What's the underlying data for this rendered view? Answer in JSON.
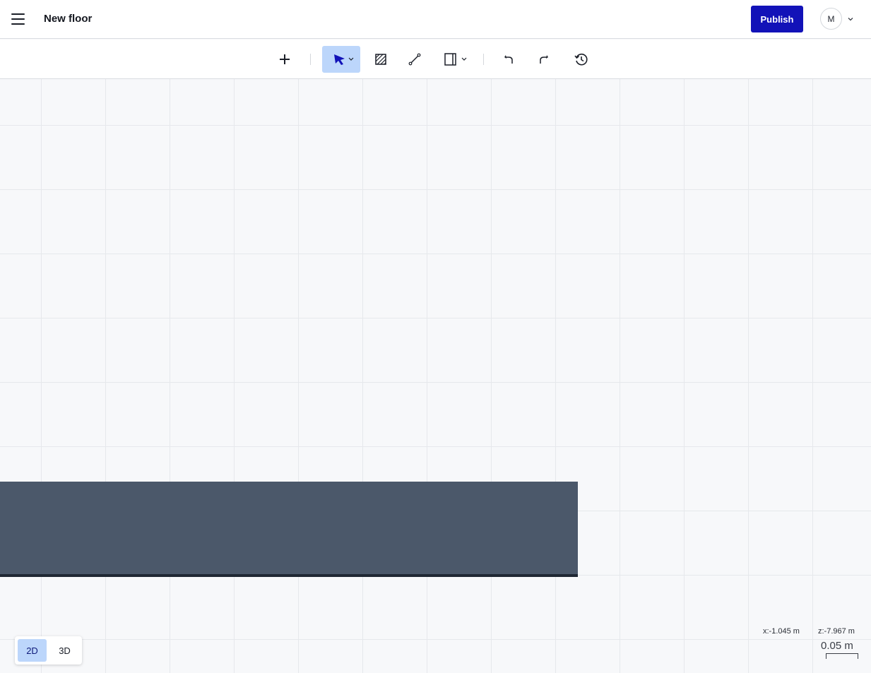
{
  "header": {
    "title": "New floor",
    "publish_label": "Publish",
    "avatar_initial": "M",
    "accent_color": "#1212b8"
  },
  "toolbar": {
    "tools": [
      {
        "icon": "plus-icon",
        "label": "Add"
      },
      {
        "icon": "cursor-arrow-icon",
        "label": "Select",
        "active": true,
        "has_dropdown": true
      },
      {
        "icon": "hatched-area-icon",
        "label": "Area"
      },
      {
        "icon": "line-icon",
        "label": "Line"
      },
      {
        "icon": "door-panel-icon",
        "label": "Door/Window",
        "has_dropdown": true
      },
      {
        "icon": "undo-icon",
        "label": "Undo"
      },
      {
        "icon": "redo-icon",
        "label": "Redo"
      },
      {
        "icon": "history-icon",
        "label": "History"
      }
    ],
    "active_color": "#bcd6fb"
  },
  "canvas": {
    "slab_color": "#4b586a",
    "view_toggle": {
      "options": [
        "2D",
        "3D"
      ],
      "selected": "2D"
    },
    "coordinates": {
      "x_label": "x:-1.045 m",
      "z_label": "z:-7.967 m"
    },
    "scale_label": "0.05 m"
  }
}
